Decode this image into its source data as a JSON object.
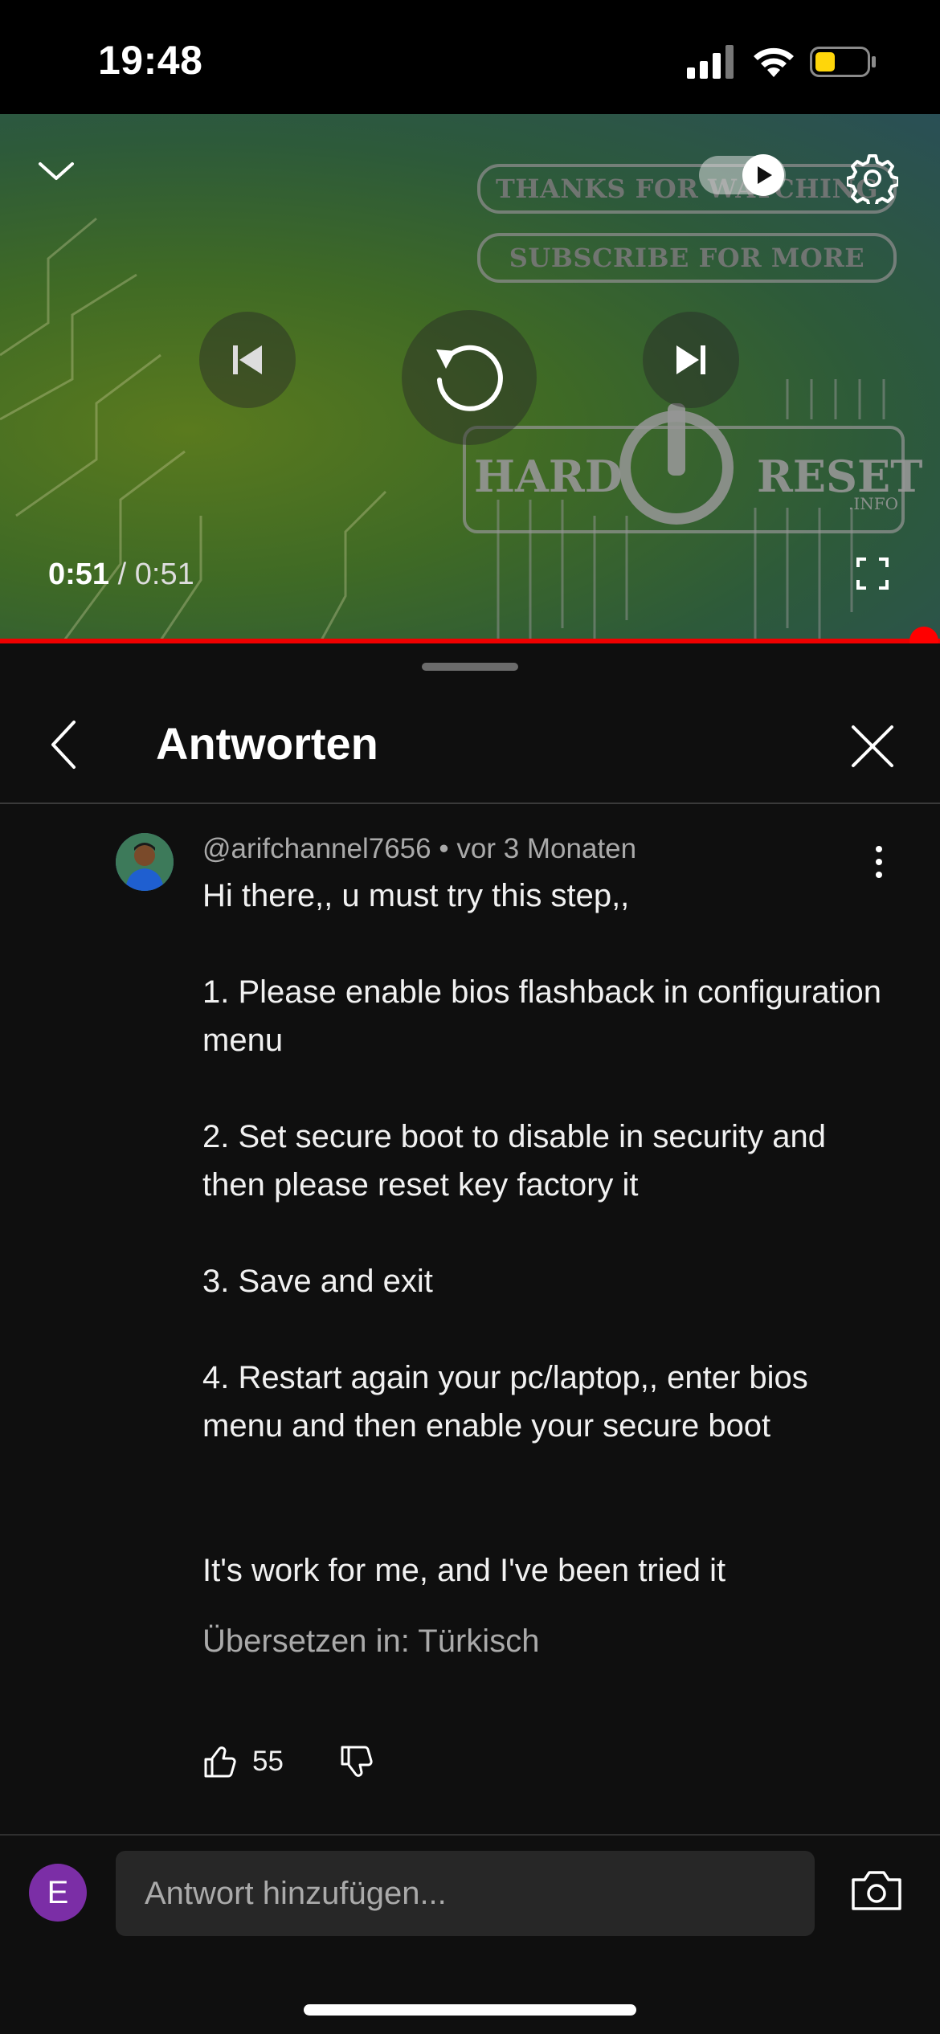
{
  "status_bar": {
    "time": "19:48"
  },
  "video": {
    "end_card_lines": [
      "THANKS FOR WATCHING",
      "SUBSCRIBE FOR MORE"
    ],
    "logo_text": [
      "HARD",
      "RESET",
      ".INFO"
    ],
    "current_time": "0:51",
    "separator": "/",
    "duration": "0:51",
    "progress": 1.0
  },
  "panel": {
    "title": "Antworten"
  },
  "comment": {
    "author": "@arifchannel7656",
    "separator": "•",
    "time_ago": "vor 3 Monaten",
    "lines": {
      "intro": "Hi there,, u must try this step,,",
      "step1": "1. Please enable bios flashback in configuration menu",
      "step2": "2. Set secure boot to disable in security and then please reset key factory it",
      "step3": "3. Save and exit",
      "step4": "4. Restart again your pc/laptop,, enter bios menu and then enable your secure boot",
      "outro": "It's work for me, and I've been tried it"
    },
    "translate_label": "Übersetzen in: Türkisch",
    "likes": "55"
  },
  "composer": {
    "user_initial": "E",
    "placeholder": "Antwort hinzufügen..."
  },
  "colors": {
    "background": "#0f0f0f",
    "progress": "#ff0000",
    "avatar_user": "#7b2ea6",
    "battery": "#ffd60a"
  }
}
